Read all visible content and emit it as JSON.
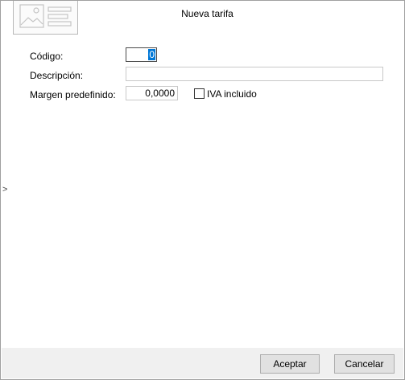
{
  "window": {
    "title": "Nueva tarifa"
  },
  "form": {
    "codigo": {
      "label": "Código:",
      "value": "0"
    },
    "descripcion": {
      "label": "Descripción:",
      "value": ""
    },
    "margen": {
      "label": "Margen predefinido:",
      "value": "0,0000"
    },
    "iva": {
      "label": "IVA incluido",
      "checked": false
    }
  },
  "footer": {
    "accept_label": "Aceptar",
    "cancel_label": "Cancelar"
  },
  "side": {
    "arrow": ">"
  }
}
